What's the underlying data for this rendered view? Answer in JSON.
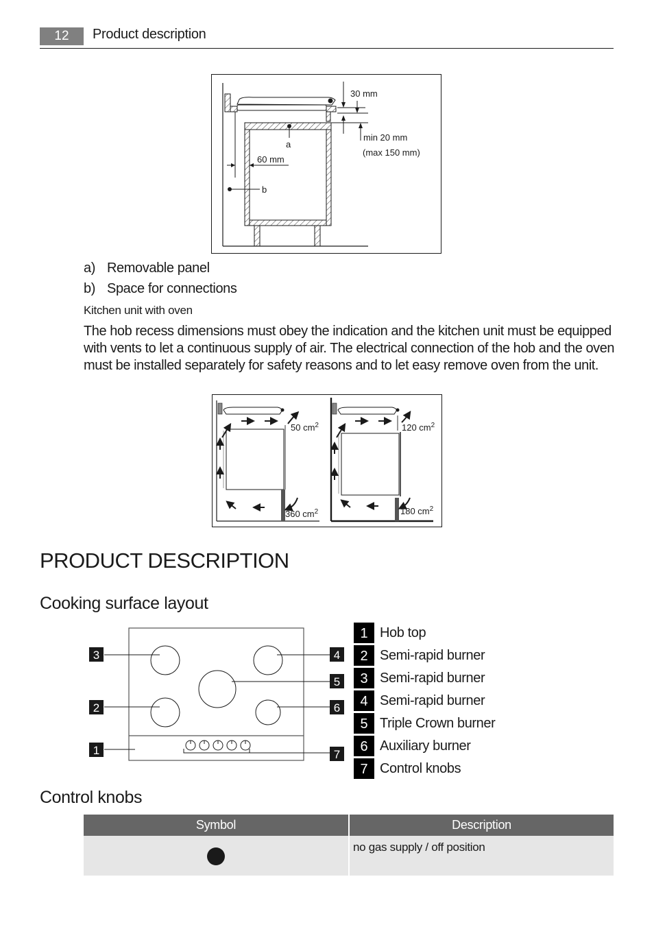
{
  "header": {
    "page_number": "12",
    "section_title": "Product description"
  },
  "installation_figure": {
    "labels": {
      "dim_30": "30 mm",
      "dim_min20": "min 20 mm",
      "dim_max150": "(max 150 mm)",
      "dim_60": "60 mm",
      "point_a": "a",
      "point_b": "b"
    }
  },
  "legend_list": [
    {
      "key": "a)",
      "text": "Removable panel"
    },
    {
      "key": "b)",
      "text": "Space for connections"
    }
  ],
  "caption": "Kitchen unit with oven",
  "paragraph": "The hob recess dimensions must obey the indication and the kitchen unit must be equipped with vents to let a continuous supply of air. The electrical connection of the hob and the oven must be installed separately for safety reasons and to let easy remove oven from the unit.",
  "ventilation_figure": {
    "left": {
      "top_vent": "50 cm",
      "bottom_vent": "360 cm",
      "sup": "2"
    },
    "right": {
      "top_vent": "120 cm",
      "bottom_vent": "180 cm",
      "sup": "2"
    }
  },
  "main_title": "PRODUCT DESCRIPTION",
  "cooking_surface": {
    "heading": "Cooking surface layout",
    "callouts": [
      "1",
      "2",
      "3",
      "4",
      "5",
      "6",
      "7"
    ],
    "items": [
      {
        "num": "1",
        "label": "Hob top"
      },
      {
        "num": "2",
        "label": "Semi-rapid burner"
      },
      {
        "num": "3",
        "label": "Semi-rapid burner"
      },
      {
        "num": "4",
        "label": "Semi-rapid burner"
      },
      {
        "num": "5",
        "label": "Triple Crown burner"
      },
      {
        "num": "6",
        "label": "Auxiliary burner"
      },
      {
        "num": "7",
        "label": "Control knobs"
      }
    ]
  },
  "control_knobs": {
    "heading": "Control knobs",
    "table": {
      "headers": [
        "Symbol",
        "Description"
      ],
      "rows": [
        {
          "symbol": "filled-circle-icon",
          "description": "no gas supply / off position"
        }
      ]
    }
  }
}
